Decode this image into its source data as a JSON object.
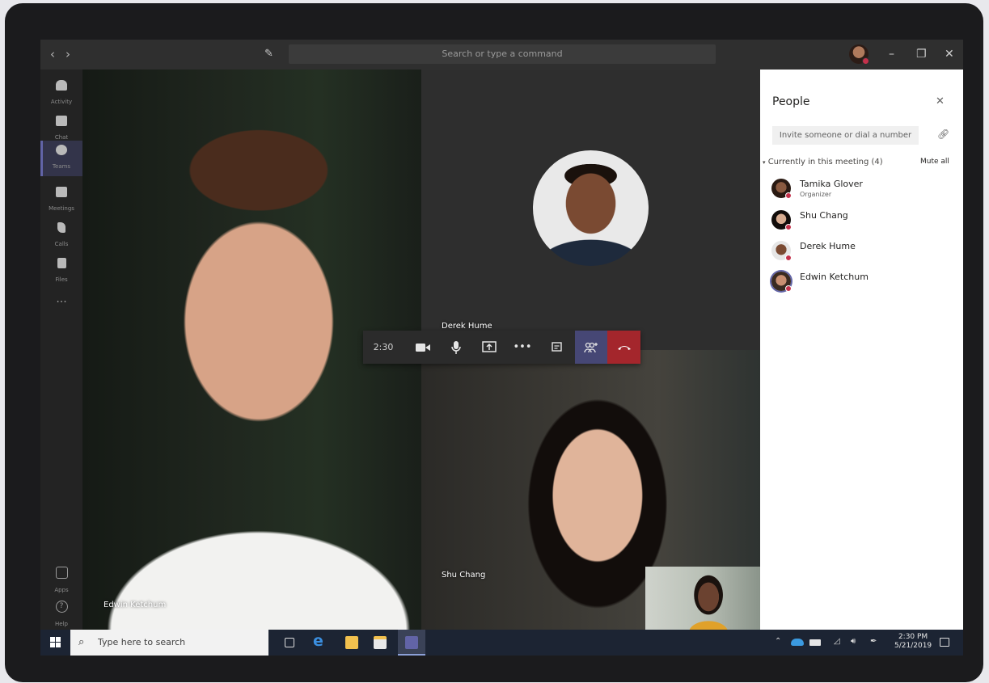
{
  "titlebar": {
    "back": "‹",
    "forward": "›",
    "search_placeholder": "Search or type a command",
    "minimize": "–",
    "maximize": "❐",
    "close": "✕"
  },
  "rail": {
    "items": [
      {
        "label": "Activity",
        "icon": "bell-icon"
      },
      {
        "label": "Chat",
        "icon": "chat-icon"
      },
      {
        "label": "Teams",
        "icon": "teams-icon"
      },
      {
        "label": "Meetings",
        "icon": "calendar-icon"
      },
      {
        "label": "Calls",
        "icon": "phone-icon"
      },
      {
        "label": "Files",
        "icon": "file-icon"
      }
    ],
    "more": "···",
    "apps": "Apps",
    "help": "Help",
    "active_index": 2
  },
  "tiles": {
    "main_name": "Edwin Ketchum",
    "top_name": "Derek Hume",
    "bottom_name": "Shu Chang"
  },
  "callbar": {
    "time": "2:30",
    "buttons": [
      "camera-icon",
      "mic-icon",
      "share-icon",
      "more-icon",
      "chat-icon",
      "add-people-icon",
      "hangup-icon"
    ]
  },
  "people": {
    "title": "People",
    "invite_placeholder": "Invite someone or dial a number",
    "section_label": "Currently in this meeting (4)",
    "mute_all": "Mute all",
    "participants": [
      {
        "name": "Tamika Glover",
        "role": "Organizer"
      },
      {
        "name": "Shu Chang",
        "role": ""
      },
      {
        "name": "Derek Hume",
        "role": ""
      },
      {
        "name": "Edwin Ketchum",
        "role": ""
      }
    ]
  },
  "taskbar": {
    "search_placeholder": "Type here to search",
    "time": "2:30 PM",
    "date": "5/21/2019"
  },
  "colors": {
    "accent": "#6264a7",
    "hangup": "#a4262c",
    "presence_busy": "#c4314b",
    "taskbar": "#1c2433"
  }
}
